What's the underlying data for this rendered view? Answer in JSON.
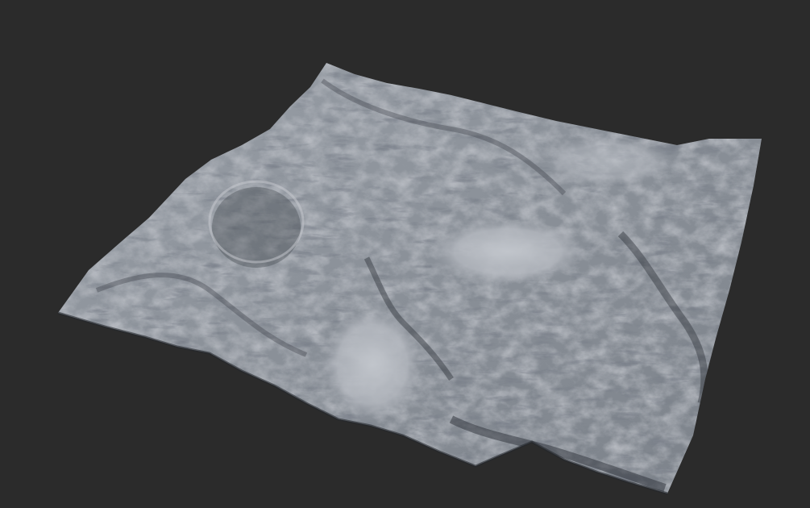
{
  "scene": {
    "subject": "terrain-heightmap-render",
    "colors": {
      "background": "#2b2b2b",
      "terrain_base": "#8c929a",
      "terrain_highlight": "#c9ccd2",
      "terrain_shadow": "#3a3e45",
      "plateau": "#b9bdc4"
    }
  }
}
